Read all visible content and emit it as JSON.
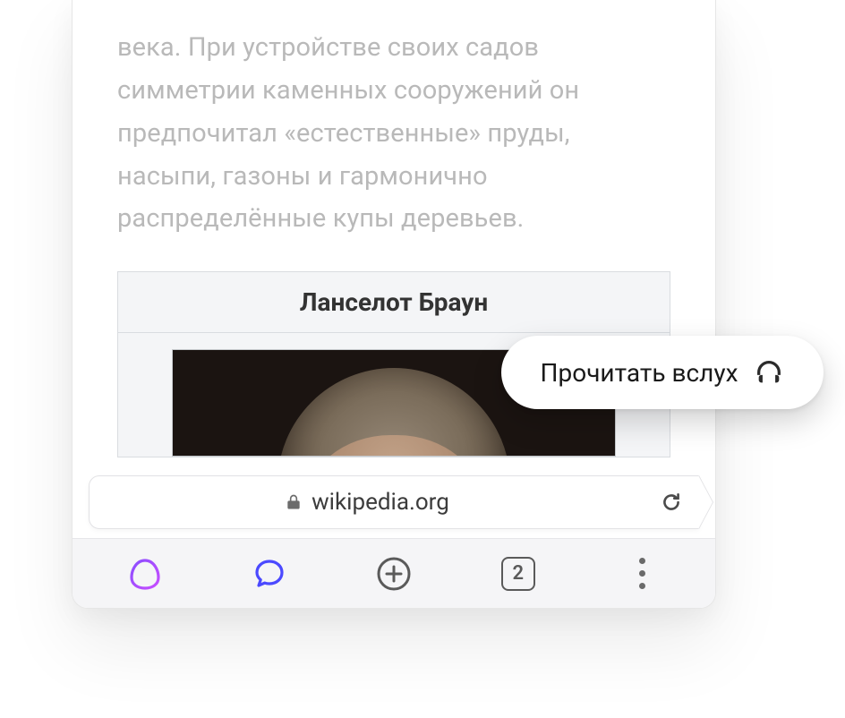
{
  "article": {
    "body_text": "века. При устройстве своих садов симметрии каменных сооружений он предпочитал «естественные» пруды, насыпи, газоны и гармонично распределённые купы деревьев.",
    "infobox_title": "Ланселот Браун"
  },
  "read_aloud": {
    "label": "Прочитать вслух"
  },
  "urlbar": {
    "domain": "wikipedia.org"
  },
  "toolbar": {
    "tab_count": "2"
  }
}
